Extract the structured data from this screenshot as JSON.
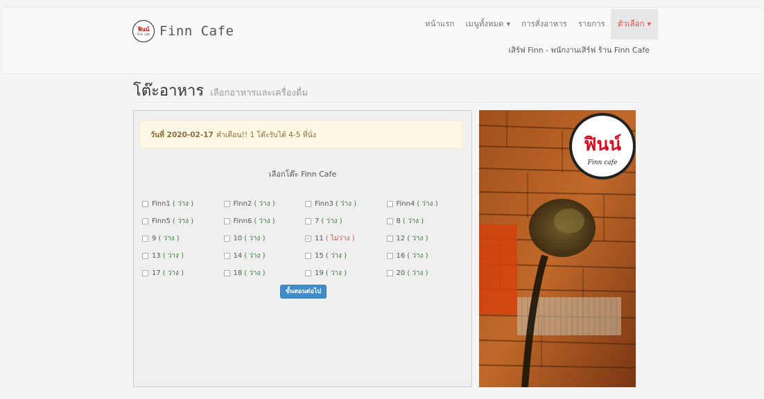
{
  "brand": {
    "logo_text": "ฟินน์",
    "logo_sub": "Finn cafe",
    "name": "Finn Cafe"
  },
  "nav": {
    "items": [
      {
        "label": "หน้าแรก"
      },
      {
        "label": "เมนูทั้งหมด",
        "has_caret": true
      },
      {
        "label": "การสั่งอาหาร"
      },
      {
        "label": "รายการ"
      },
      {
        "label": "ตัวเลือก",
        "has_caret": true,
        "active": true
      }
    ],
    "user_line": "เสิร์ฟ Finn - พนักงานเสิร์ฟ ร้าน Finn Cafe"
  },
  "page": {
    "title": "โต๊ะอาหาร",
    "subtitle": "เลือกอาหารและเครื่องดื่ม"
  },
  "alert": {
    "date_label": "วันที่ 2020-02-17",
    "message": "คำเตือน!! 1 โต๊ะรับได้ 4-5 ที่นั่ง"
  },
  "tables": {
    "title": "เลือกโต๊ะ Finn Cafe",
    "status_free": "( ว่าง )",
    "status_busy": "( ไม่ว่าง )",
    "rows": [
      [
        {
          "name": "Finn1",
          "busy": false
        },
        {
          "name": "Finn2",
          "busy": false
        },
        {
          "name": "Finn3",
          "busy": false
        },
        {
          "name": "Finn4",
          "busy": false
        }
      ],
      [
        {
          "name": "Finn5",
          "busy": false
        },
        {
          "name": "Finn6",
          "busy": false
        },
        {
          "name": "7",
          "busy": false
        },
        {
          "name": "8",
          "busy": false
        }
      ],
      [
        {
          "name": "9",
          "busy": false
        },
        {
          "name": "10",
          "busy": false
        },
        {
          "name": "11",
          "busy": true,
          "checked": true
        },
        {
          "name": "12",
          "busy": false
        }
      ],
      [
        {
          "name": "13",
          "busy": false
        },
        {
          "name": "14",
          "busy": false
        },
        {
          "name": "15",
          "busy": false
        },
        {
          "name": "16",
          "busy": false
        }
      ],
      [
        {
          "name": "17",
          "busy": false
        },
        {
          "name": "18",
          "busy": false
        },
        {
          "name": "19",
          "busy": false
        },
        {
          "name": "20",
          "busy": false
        }
      ]
    ],
    "next_button": "ขั้นตอนต่อไป"
  },
  "photo": {
    "logo_text": "ฟินน์",
    "logo_sub": "Finn cafe"
  },
  "colors": {
    "accent": "#d9534f",
    "free": "#3c763d",
    "button": "#428bca",
    "alert_bg": "#fcf8e3"
  }
}
